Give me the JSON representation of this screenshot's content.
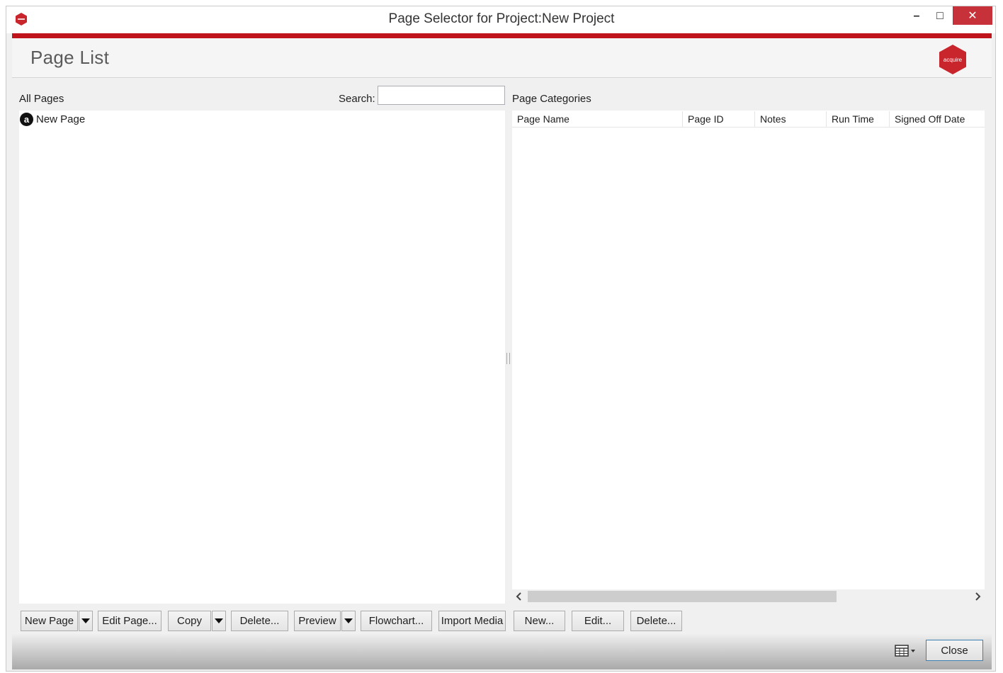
{
  "window": {
    "title": "Page Selector for Project:New Project",
    "minimize_glyph": "–",
    "maximize_glyph": "□",
    "close_glyph": "✕"
  },
  "header": {
    "title": "Page List",
    "logo_text": "acquire"
  },
  "left_panel": {
    "label": "All Pages",
    "search_label": "Search:",
    "search_value": "",
    "items": [
      {
        "icon_letter": "a",
        "label": "New Page"
      }
    ]
  },
  "right_panel": {
    "label": "Page Categories",
    "columns": [
      "Page Name",
      "Page ID",
      "Notes",
      "Run Time",
      "Signed Off Date"
    ],
    "rows": []
  },
  "buttons": {
    "new_page": "New Page",
    "edit_page": "Edit Page...",
    "copy": "Copy",
    "delete_page": "Delete...",
    "preview": "Preview",
    "flowchart": "Flowchart...",
    "import_media": "Import Media",
    "new_category": "New...",
    "edit_category": "Edit...",
    "delete_category": "Delete...",
    "close": "Close"
  },
  "colors": {
    "accent_red": "#c0141c",
    "close_button_red": "#c7323a",
    "focus_blue": "#3c7fb1"
  },
  "icons": {
    "app": "acquire-hexagon-icon",
    "view_toggle": "grid-view-icon",
    "scroll_left": "chevron-left-icon",
    "scroll_right": "chevron-right-icon"
  }
}
